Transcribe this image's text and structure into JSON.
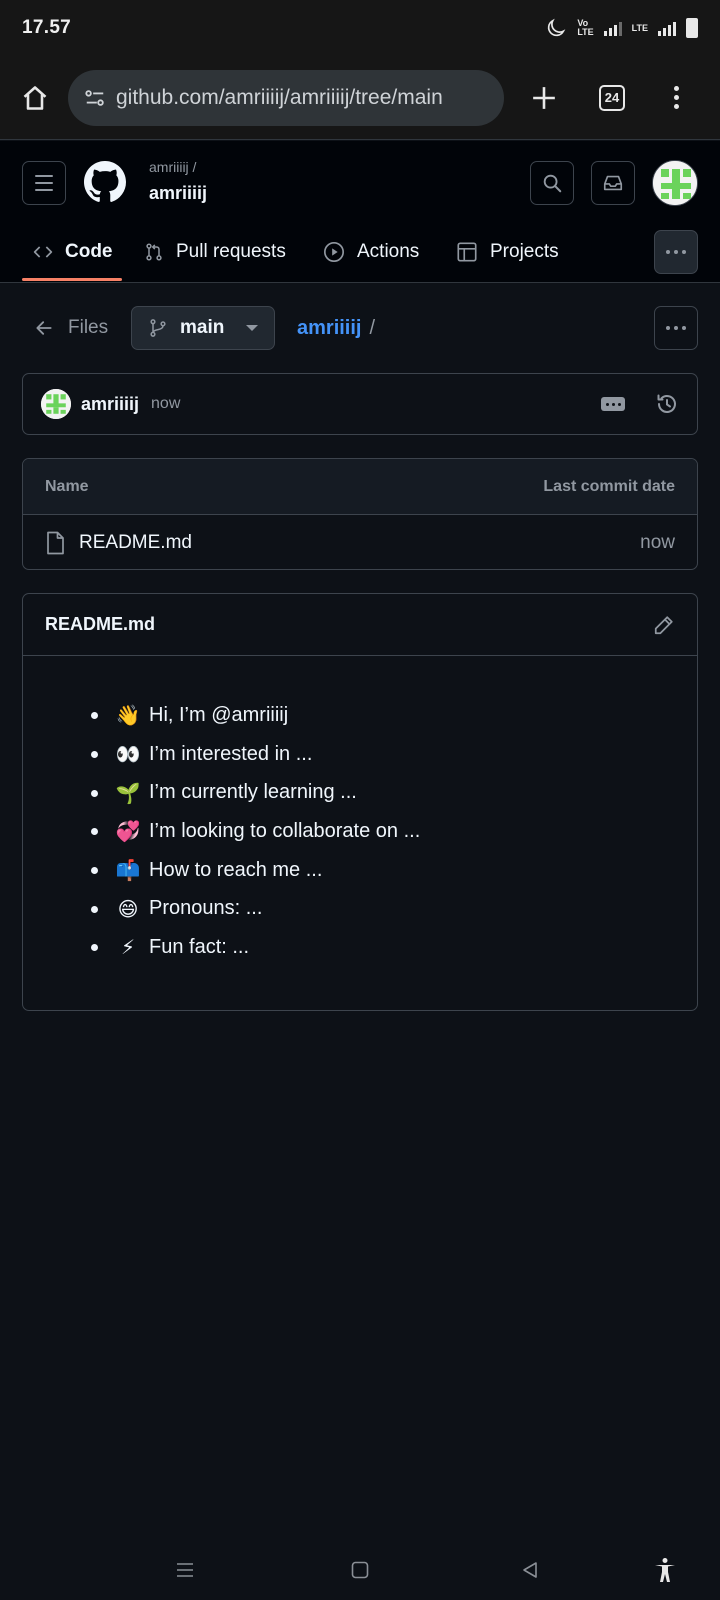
{
  "status_bar": {
    "time": "17.57",
    "volte_label": "Vo\nLTE",
    "lte_label": "LTE"
  },
  "browser": {
    "url": "github.com/amriiiij/amriiiij/tree/main",
    "tab_count": "24"
  },
  "repo": {
    "owner": "amriiiij /",
    "name": "amriiiij"
  },
  "nav": {
    "tabs": [
      {
        "label": "Code",
        "icon": "code-icon",
        "active": true
      },
      {
        "label": "Pull requests",
        "icon": "pull-request-icon"
      },
      {
        "label": "Actions",
        "icon": "play-icon"
      },
      {
        "label": "Projects",
        "icon": "table-icon"
      }
    ]
  },
  "files_bar": {
    "back_label": "Files",
    "branch": "main",
    "breadcrumb": "amriiiij",
    "separator": "/"
  },
  "commit": {
    "author": "amriiiij",
    "time": "now"
  },
  "file_table": {
    "col_name": "Name",
    "col_date": "Last commit date",
    "rows": [
      {
        "name": "README.md",
        "date": "now"
      }
    ]
  },
  "readme": {
    "title": "README.md",
    "items": [
      {
        "emoji": "👋",
        "text": "Hi, I’m @amriiiij"
      },
      {
        "emoji": "👀",
        "text": "I’m interested in ..."
      },
      {
        "emoji": "🌱",
        "text": "I’m currently learning ..."
      },
      {
        "emoji": "💞",
        "text": "I’m looking to collaborate on ..."
      },
      {
        "emoji": "📫",
        "text": "How to reach me ..."
      },
      {
        "emoji": "😄",
        "text": "Pronouns: ..."
      },
      {
        "emoji": "⚡",
        "text": "Fun fact: ..."
      }
    ]
  },
  "colors": {
    "background": "#0d1117",
    "header_bg": "#010409",
    "accent_link": "#4493f8",
    "active_tab_underline": "#f78166",
    "border": "#3d444d"
  }
}
